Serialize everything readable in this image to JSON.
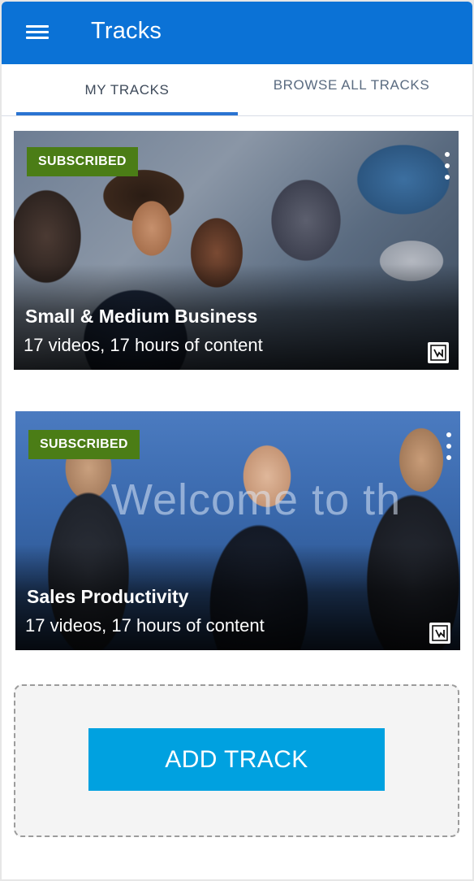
{
  "header": {
    "title": "Tracks",
    "background": "#0b72d6"
  },
  "tabs": [
    {
      "label": "MY TRACKS",
      "active": true
    },
    {
      "label": "BROWSE ALL TRACKS",
      "active": false
    }
  ],
  "tracks": [
    {
      "badge": "SUBSCRIBED",
      "title": "Small & Medium Business",
      "subtitle": "17 videos, 17 hours of content"
    },
    {
      "badge": "SUBSCRIBED",
      "title": "Sales Productivity",
      "subtitle": "17 videos, 17 hours of content",
      "background_text": "Welcome to th"
    }
  ],
  "add_track": {
    "label": "ADD TRACK",
    "color": "#00a1e0"
  },
  "colors": {
    "badge": "#4b7d16",
    "tab_underline": "#2a74d2"
  }
}
